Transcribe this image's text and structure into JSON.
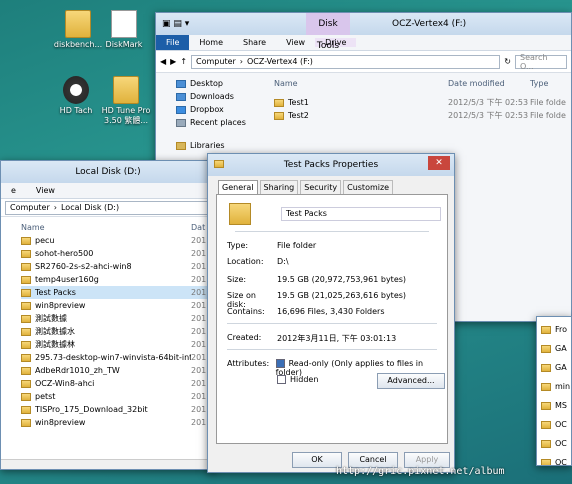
{
  "desktop": {
    "icons": [
      "diskbench...",
      "DiskMark",
      "HD Tach",
      "HD Tune Pro 3.50 繁體..."
    ]
  },
  "explorer_top": {
    "title": "OCZ-Vertex4 (F:)",
    "context_tab": "Disk Tools",
    "tabs": [
      "File",
      "Home",
      "Share",
      "View",
      "Drive"
    ],
    "address": [
      "Computer",
      "OCZ-Vertex4 (F:)"
    ],
    "search_placeholder": "Search O...",
    "nav": [
      "Desktop",
      "Downloads",
      "Dropbox",
      "Recent places",
      "Libraries"
    ],
    "columns": [
      "Name",
      "Date modified",
      "Type"
    ],
    "files": [
      {
        "name": "Test1",
        "date": "2012/5/3 下午 02:53",
        "type": "File folde"
      },
      {
        "name": "Test2",
        "date": "2012/5/3 下午 02:53",
        "type": "File folde"
      }
    ]
  },
  "explorer_left": {
    "title": "Local Disk (D:)",
    "tabs": [
      "e",
      "View"
    ],
    "address": [
      "Computer",
      "Local Disk (D:)"
    ],
    "columns": [
      "Name",
      "Dat"
    ],
    "files": [
      {
        "name": "pecu",
        "date": "201"
      },
      {
        "name": "sohot-hero500",
        "date": "201"
      },
      {
        "name": "SR2760-2s-s2-ahci-win8",
        "date": "201"
      },
      {
        "name": "temp4user160g",
        "date": "201"
      },
      {
        "name": "Test Packs",
        "date": "201"
      },
      {
        "name": "win8preview",
        "date": "201"
      },
      {
        "name": "測試數據",
        "date": "201"
      },
      {
        "name": "測試數據水",
        "date": "201"
      },
      {
        "name": "測試數據林",
        "date": "201"
      },
      {
        "name": "295.73-desktop-win7-winvista-64bit-inte...",
        "date": "201"
      },
      {
        "name": "AdbeRdr1010_zh_TW",
        "date": "201"
      },
      {
        "name": "OCZ-Win8-ahci",
        "date": "201"
      },
      {
        "name": "petst",
        "date": "201"
      },
      {
        "name": "TISPro_175_Download_32bit",
        "date": "201"
      },
      {
        "name": "win8preview",
        "date": "201"
      }
    ]
  },
  "explorer_right_fragments": [
    "Fro",
    "GA",
    "GA",
    "min",
    "MS",
    "OC",
    "OC",
    "OC"
  ],
  "dialog": {
    "title": "Test Packs Properties",
    "tabs": [
      "General",
      "Sharing",
      "Security",
      "Customize"
    ],
    "name_value": "Test Packs",
    "props": [
      {
        "k": "Type:",
        "v": "File folder"
      },
      {
        "k": "Location:",
        "v": "D:\\"
      },
      {
        "k": "Size:",
        "v": "19.5 GB (20,972,753,961 bytes)"
      },
      {
        "k": "Size on disk:",
        "v": "19.5 GB (21,025,263,616 bytes)"
      },
      {
        "k": "Contains:",
        "v": "16,696 Files, 3,430 Folders"
      },
      {
        "k": "Created:",
        "v": "2012年3月11日, 下午 03:01:13"
      }
    ],
    "attributes_label": "Attributes:",
    "readonly_label": "Read-only (Only applies to files in folder)",
    "hidden_label": "Hidden",
    "advanced_label": "Advanced...",
    "ok": "OK",
    "cancel": "Cancel",
    "apply": "Apply"
  },
  "watermark": "http://gric.pixnet.net/album"
}
